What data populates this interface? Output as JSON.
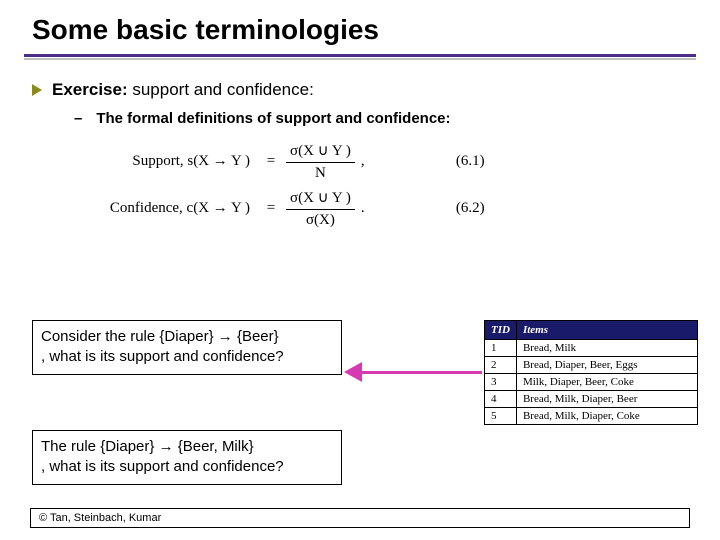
{
  "title": "Some basic terminologies",
  "bullet1": {
    "label": "Exercise:",
    "rest": " support and confidence:"
  },
  "bullet2": "The formal definitions of support and confidence:",
  "eq": {
    "support_label": "Support, s(X → Y )",
    "support_num": "σ(X ∪ Y )",
    "support_den": "N",
    "support_ref": "(6.1)",
    "conf_label": "Confidence, c(X → Y )",
    "conf_num": "σ(X ∪ Y )",
    "conf_den": "σ(X)",
    "conf_ref": "(6.2)",
    "eq": "=",
    "comma": ",",
    "dot": "."
  },
  "q1_line1": "Consider the rule {Diaper} → {Beer}",
  "q1_line2": ", what is its support and confidence?",
  "q2_line1": "The rule {Diaper} → {Beer, Milk}",
  "q2_line2": ", what is its support and confidence?",
  "table": {
    "h1": "TID",
    "h2": "Items",
    "rows": [
      {
        "tid": "1",
        "items": "Bread, Milk"
      },
      {
        "tid": "2",
        "items": "Bread, Diaper, Beer, Eggs"
      },
      {
        "tid": "3",
        "items": "Milk, Diaper, Beer, Coke"
      },
      {
        "tid": "4",
        "items": "Bread, Milk, Diaper, Beer"
      },
      {
        "tid": "5",
        "items": "Bread, Milk, Diaper, Coke"
      }
    ]
  },
  "footer": "© Tan, Steinbach, Kumar"
}
